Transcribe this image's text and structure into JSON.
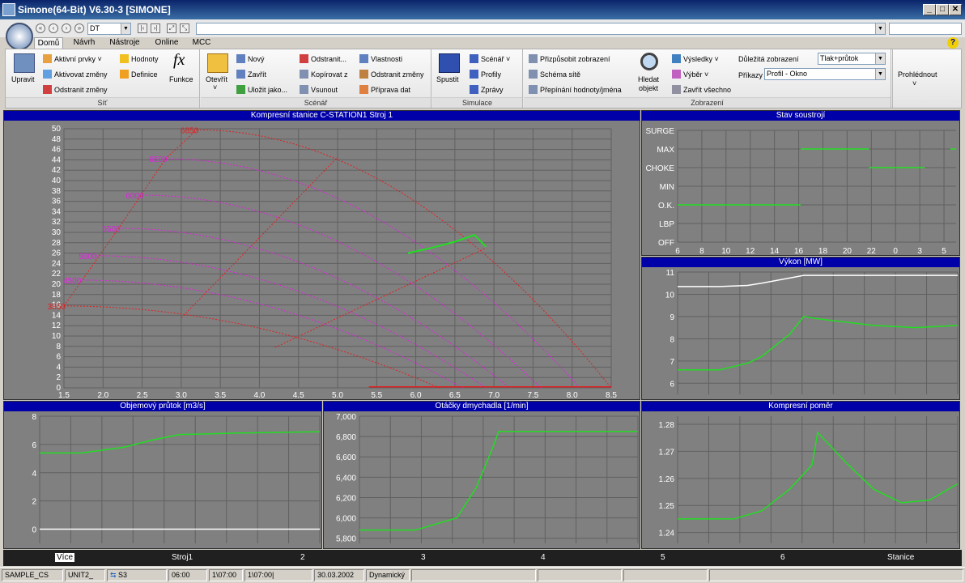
{
  "window": {
    "title": "Simone(64-Bit) V6.30-3 [SIMONE]",
    "buttons": [
      "_",
      "□",
      "✕"
    ]
  },
  "nav": {
    "combo_value": "DT"
  },
  "ribbon_tabs": [
    "Domů",
    "Návrh",
    "Nástroje",
    "Online",
    "MCC"
  ],
  "groups": {
    "sit": {
      "label": "Síť",
      "upravit": "Upravit",
      "aktivni_prvky": "Aktivní prvky",
      "aktivovat_zmeny": "Aktivovat změny",
      "odstranit_zmeny": "Odstranit změny",
      "hodnoty": "Hodnoty",
      "definice": "Definice",
      "funkce": "Funkce"
    },
    "scenar": {
      "label": "Scénář",
      "otevrit": "Otevřít",
      "novy": "Nový",
      "zavrit": "Zavřít",
      "ulozit": "Uložit jako...",
      "odstranit": "Odstranit...",
      "kopirovat": "Kopírovat z",
      "vsunout": "Vsunout",
      "vlastnosti": "Vlastnosti",
      "odstranit_zmeny": "Odstranit změny",
      "priprava": "Příprava dat"
    },
    "simulace": {
      "label": "Simulace",
      "spustit": "Spustit",
      "scenar": "Scénář",
      "profily": "Profily",
      "zpravy": "Zprávy"
    },
    "zobrazeni": {
      "label": "Zobrazení",
      "prizpusobit": "Přizpůsobit zobrazení",
      "schema": "Schéma sítě",
      "prepinani": "Přepínání hodnoty/jména",
      "hledat": "Hledat",
      "objekt": "objekt",
      "vysledky": "Výsledky",
      "vyber": "Výběr",
      "zavrit_vse": "Zavřít všechno",
      "dulezita_label": "Důležitá zobrazení",
      "dulezita_value": "Tlak+průtok",
      "prikazy_label": "Příkazy",
      "prikazy_value": "Profil - Okno"
    },
    "prohlednout": "Prohlédnout"
  },
  "panels": {
    "main": "Kompresní stanice C-STATION1 Stroj 1",
    "stav": "Stav soustrojí",
    "vykon": "Výkon [MW]",
    "objem": "Objemový průtok [m3/s]",
    "otacky": "Otáčky dmychadla [1/min]",
    "pomer": "Kompresní poměr"
  },
  "chart_data": [
    {
      "type": "line",
      "title": "Kompresní stanice C-STATION1 Stroj 1",
      "xlim": [
        1.5,
        8.5
      ],
      "ylim": [
        0,
        50
      ],
      "x_ticks": [
        "1.5",
        "2.0",
        "2.5",
        "3.0",
        "3.5",
        "4.0",
        "4.5",
        "5.0",
        "5.5",
        "6.0",
        "6.5",
        "7.0",
        "7.5",
        "8.0",
        "8.5"
      ],
      "y_ticks": [
        "0",
        "2",
        "4",
        "6",
        "8",
        "10",
        "12",
        "14",
        "16",
        "18",
        "20",
        "22",
        "24",
        "26",
        "28",
        "30",
        "32",
        "34",
        "36",
        "38",
        "40",
        "42",
        "44",
        "46",
        "48",
        "50"
      ],
      "speed_labels": [
        "6850",
        "6500",
        "6000",
        "5500",
        "5000",
        "4500",
        "3850"
      ],
      "series": [
        {
          "x": [
            5.9,
            6.2,
            6.5,
            6.75,
            6.9
          ],
          "y": [
            26.0,
            27.0,
            28.2,
            29.5,
            27.2
          ]
        }
      ]
    },
    {
      "type": "line",
      "title": "Stav soustrojí",
      "y_categories": [
        "SURGE",
        "MAX",
        "CHOKE",
        "MIN",
        "O.K.",
        "LBP",
        "OFF"
      ],
      "x_ticks": [
        "6",
        "8",
        "10",
        "12",
        "14",
        "16",
        "18",
        "20",
        "22",
        "0",
        "3",
        "5"
      ],
      "series": [
        {
          "segments": [
            {
              "state": "O.K.",
              "x": [
                6,
                16.6
              ]
            },
            {
              "state": "MAX",
              "x": [
                16.6,
                22.5
              ]
            },
            {
              "state": "CHOKE",
              "x": [
                22.5,
                27.3
              ]
            },
            {
              "state": "MAX",
              "x": [
                29.5,
                30
              ]
            }
          ]
        }
      ]
    },
    {
      "type": "line",
      "title": "Výkon [MW]",
      "ylim": [
        5.5,
        11
      ],
      "y_ticks": [
        "6",
        "7",
        "8",
        "9",
        "10",
        "11"
      ],
      "series": [
        {
          "x": [
            0,
            0.15,
            0.25,
            0.3,
            0.45,
            0.5,
            1.0
          ],
          "y": [
            10.35,
            10.35,
            10.4,
            10.5,
            10.85,
            10.85,
            10.85
          ]
        },
        {
          "x": [
            0,
            0.15,
            0.25,
            0.3,
            0.4,
            0.45,
            0.5,
            0.7,
            0.85,
            1.0
          ],
          "y": [
            6.6,
            6.6,
            6.9,
            7.2,
            8.2,
            9.0,
            8.9,
            8.6,
            8.5,
            8.6
          ]
        }
      ]
    },
    {
      "type": "line",
      "title": "Objemový průtok [m3/s]",
      "ylim": [
        -1,
        8
      ],
      "y_ticks": [
        "0",
        "2",
        "4",
        "6",
        "8"
      ],
      "series": [
        {
          "x": [
            0,
            1.0
          ],
          "y": [
            0,
            0
          ]
        },
        {
          "x": [
            0,
            0.15,
            0.3,
            0.4,
            0.5,
            0.7,
            1.0
          ],
          "y": [
            5.4,
            5.4,
            5.8,
            6.3,
            6.7,
            6.8,
            6.9
          ]
        }
      ]
    },
    {
      "type": "line",
      "title": "Otáčky dmychadla [1/min]",
      "ylim": [
        5750,
        7000
      ],
      "y_ticks": [
        "5,800",
        "6,000",
        "6,200",
        "6,400",
        "6,600",
        "6,800",
        "7,000"
      ],
      "series": [
        {
          "x": [
            0,
            0.2,
            0.35,
            0.42,
            0.48,
            0.5,
            1.0
          ],
          "y": [
            5880,
            5880,
            6000,
            6300,
            6700,
            6850,
            6850
          ]
        }
      ]
    },
    {
      "type": "line",
      "title": "Kompresní poměr",
      "ylim": [
        1.236,
        1.283
      ],
      "y_ticks": [
        "1.24",
        "1.25",
        "1.26",
        "1.27",
        "1.28"
      ],
      "series": [
        {
          "x": [
            0,
            0.2,
            0.3,
            0.4,
            0.48,
            0.5,
            0.6,
            0.7,
            0.8,
            0.9,
            1.0
          ],
          "y": [
            1.245,
            1.245,
            1.248,
            1.256,
            1.265,
            1.277,
            1.266,
            1.256,
            1.251,
            1.252,
            1.258
          ]
        }
      ]
    }
  ],
  "bottom_tabs": [
    "Více",
    "Stroj1",
    "2",
    "3",
    "4",
    "5",
    "6",
    "Stanice"
  ],
  "status": [
    "SAMPLE_CS",
    "UNIT2_",
    "S3",
    "06:00",
    "1\\07:00",
    "1\\07:00|",
    "30.03.2002",
    "Dynamický"
  ],
  "colors": {
    "green": "#22dd22",
    "red": "#e02020",
    "magenta": "#e020e0",
    "grid": "#606060",
    "plot_bg": "#808080",
    "header": "#0000a8"
  }
}
